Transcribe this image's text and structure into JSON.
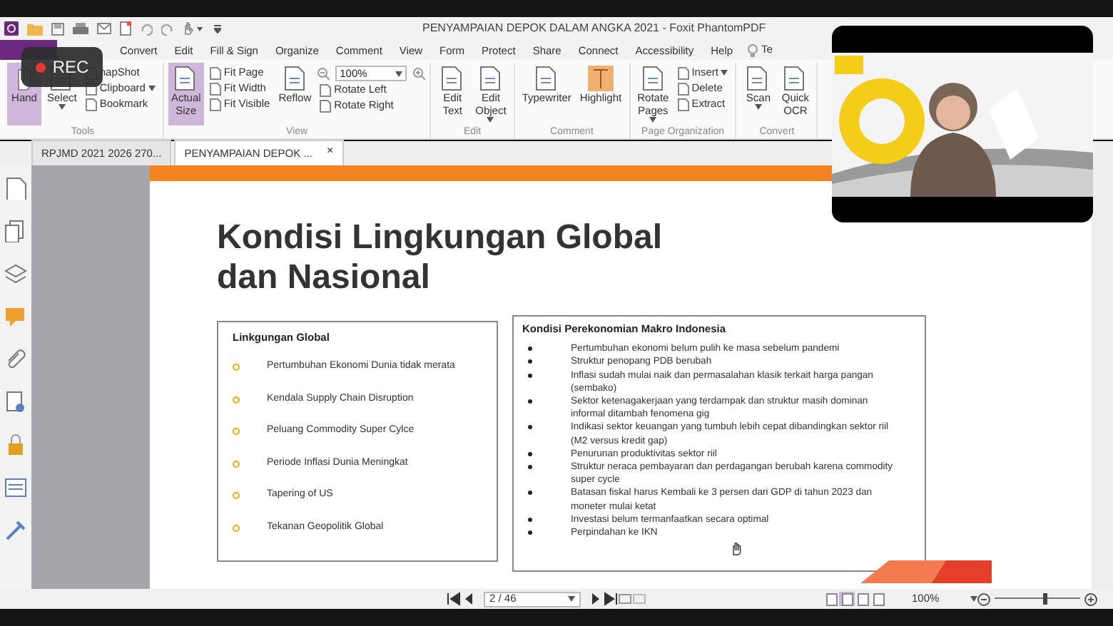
{
  "window": {
    "title": "PENYAMPAIAN DEPOK DALAM ANGKA 2021 - Foxit PhantomPDF"
  },
  "recording": {
    "label": "REC"
  },
  "menu_tabs": [
    {
      "label": "Convert"
    },
    {
      "label": "Edit"
    },
    {
      "label": "Fill & Sign"
    },
    {
      "label": "Organize"
    },
    {
      "label": "Comment"
    },
    {
      "label": "View"
    },
    {
      "label": "Form"
    },
    {
      "label": "Protect"
    },
    {
      "label": "Share"
    },
    {
      "label": "Connect"
    },
    {
      "label": "Accessibility"
    },
    {
      "label": "Help"
    }
  ],
  "tell_me": {
    "label": "Te"
  },
  "ribbon": [
    {
      "label": "Tools",
      "items": [
        {
          "kind": "large",
          "lines": [
            "Hand"
          ],
          "selected": true
        },
        {
          "kind": "large",
          "lines": [
            "Select"
          ],
          "dropdown": true
        },
        {
          "kind": "stack",
          "items": [
            {
              "label": "napShot"
            },
            {
              "label": "Clipboard",
              "dropdown": true
            },
            {
              "label": "Bookmark"
            }
          ]
        }
      ]
    },
    {
      "label": "View",
      "items": [
        {
          "kind": "large",
          "lines": [
            "Actual",
            "Size"
          ],
          "selected": true
        },
        {
          "kind": "stack",
          "items": [
            {
              "label": "Fit Page"
            },
            {
              "label": "Fit Width"
            },
            {
              "label": "Fit Visible"
            }
          ]
        },
        {
          "kind": "large",
          "lines": [
            "Reflow"
          ]
        },
        {
          "kind": "zoom",
          "value": "100%",
          "items": [
            {
              "label": "Rotate Left"
            },
            {
              "label": "Rotate Right"
            }
          ]
        }
      ]
    },
    {
      "label": "Edit",
      "items": [
        {
          "kind": "large",
          "lines": [
            "Edit",
            "Text"
          ]
        },
        {
          "kind": "large",
          "lines": [
            "Edit",
            "Object"
          ],
          "dropdown": true
        }
      ]
    },
    {
      "label": "Comment",
      "items": [
        {
          "kind": "large",
          "lines": [
            "Typewriter"
          ]
        },
        {
          "kind": "large",
          "lines": [
            "Highlight"
          ],
          "highlight": true
        }
      ]
    },
    {
      "label": "Page Organization",
      "items": [
        {
          "kind": "large",
          "lines": [
            "Rotate",
            "Pages"
          ],
          "dropdown": true
        },
        {
          "kind": "stack",
          "items": [
            {
              "label": "Insert",
              "dropdown": true
            },
            {
              "label": "Delete"
            },
            {
              "label": "Extract"
            }
          ]
        }
      ]
    },
    {
      "label": "Convert",
      "items": [
        {
          "kind": "large",
          "lines": [
            "Scan"
          ],
          "dropdown": true
        },
        {
          "kind": "large",
          "lines": [
            "Quick",
            "OCR"
          ]
        }
      ]
    }
  ],
  "document_tabs": [
    {
      "label": "RPJMD 2021 2026 270...",
      "selected": false
    },
    {
      "label": "PENYAMPAIAN DEPOK ...",
      "selected": true,
      "close": "×"
    }
  ],
  "slide": {
    "title": "Kondisi Lingkungan Global dan Nasional",
    "left_box": {
      "heading": "Linkgungan Global",
      "items": [
        "Pertumbuhan Ekonomi Dunia tidak merata",
        "Kendala Supply Chain Disruption",
        "Peluang Commodity Super Cylce",
        "Periode Inflasi Dunia Meningkat",
        "Tapering of US",
        "Tekanan Geopolitik Global"
      ]
    },
    "right_box": {
      "heading": "Kondisi Perekonomian Makro Indonesia",
      "items": [
        "Pertumbuhan ekonomi belum pulih ke masa sebelum pandemi",
        "Struktur penopang PDB berubah",
        "Inflasi sudah mulai naik dan permasalahan klasik terkait harga pangan (sembako)",
        "Sektor ketenagakerjaan yang terdampak dan struktur masih dominan informal ditambah fenomena gig",
        "Indikasi sektor keuangan yang tumbuh lebih cepat dibandingkan sektor riil (M2 versus kredit gap)",
        "Penurunan produktivitas sektor riil",
        "Struktur neraca pembayaran dan perdagangan berubah karena commodity super cycle",
        "Batasan fiskal harus Kembali ke 3 persen dari GDP di tahun 2023 dan moneter mulai ketat",
        "Investasi belum termanfaatkan secara optimal",
        "Perpindahan ke IKN"
      ]
    }
  },
  "status_bar": {
    "page": "2 / 46",
    "view_modes": [
      {
        "selected": false
      },
      {
        "selected": true
      },
      {
        "selected": false
      },
      {
        "selected": false
      }
    ],
    "zoom": "100%",
    "zoom_slider": {
      "level": 0.6
    }
  }
}
